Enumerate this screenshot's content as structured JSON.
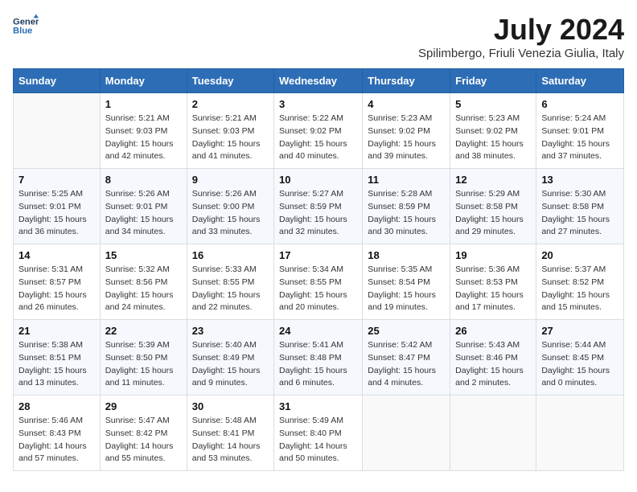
{
  "header": {
    "logo_line1": "General",
    "logo_line2": "Blue",
    "title": "July 2024",
    "location": "Spilimbergo, Friuli Venezia Giulia, Italy"
  },
  "weekdays": [
    "Sunday",
    "Monday",
    "Tuesday",
    "Wednesday",
    "Thursday",
    "Friday",
    "Saturday"
  ],
  "weeks": [
    [
      {
        "day": "",
        "sunrise": "",
        "sunset": "",
        "daylight": ""
      },
      {
        "day": "1",
        "sunrise": "Sunrise: 5:21 AM",
        "sunset": "Sunset: 9:03 PM",
        "daylight": "Daylight: 15 hours and 42 minutes."
      },
      {
        "day": "2",
        "sunrise": "Sunrise: 5:21 AM",
        "sunset": "Sunset: 9:03 PM",
        "daylight": "Daylight: 15 hours and 41 minutes."
      },
      {
        "day": "3",
        "sunrise": "Sunrise: 5:22 AM",
        "sunset": "Sunset: 9:02 PM",
        "daylight": "Daylight: 15 hours and 40 minutes."
      },
      {
        "day": "4",
        "sunrise": "Sunrise: 5:23 AM",
        "sunset": "Sunset: 9:02 PM",
        "daylight": "Daylight: 15 hours and 39 minutes."
      },
      {
        "day": "5",
        "sunrise": "Sunrise: 5:23 AM",
        "sunset": "Sunset: 9:02 PM",
        "daylight": "Daylight: 15 hours and 38 minutes."
      },
      {
        "day": "6",
        "sunrise": "Sunrise: 5:24 AM",
        "sunset": "Sunset: 9:01 PM",
        "daylight": "Daylight: 15 hours and 37 minutes."
      }
    ],
    [
      {
        "day": "7",
        "sunrise": "Sunrise: 5:25 AM",
        "sunset": "Sunset: 9:01 PM",
        "daylight": "Daylight: 15 hours and 36 minutes."
      },
      {
        "day": "8",
        "sunrise": "Sunrise: 5:26 AM",
        "sunset": "Sunset: 9:01 PM",
        "daylight": "Daylight: 15 hours and 34 minutes."
      },
      {
        "day": "9",
        "sunrise": "Sunrise: 5:26 AM",
        "sunset": "Sunset: 9:00 PM",
        "daylight": "Daylight: 15 hours and 33 minutes."
      },
      {
        "day": "10",
        "sunrise": "Sunrise: 5:27 AM",
        "sunset": "Sunset: 8:59 PM",
        "daylight": "Daylight: 15 hours and 32 minutes."
      },
      {
        "day": "11",
        "sunrise": "Sunrise: 5:28 AM",
        "sunset": "Sunset: 8:59 PM",
        "daylight": "Daylight: 15 hours and 30 minutes."
      },
      {
        "day": "12",
        "sunrise": "Sunrise: 5:29 AM",
        "sunset": "Sunset: 8:58 PM",
        "daylight": "Daylight: 15 hours and 29 minutes."
      },
      {
        "day": "13",
        "sunrise": "Sunrise: 5:30 AM",
        "sunset": "Sunset: 8:58 PM",
        "daylight": "Daylight: 15 hours and 27 minutes."
      }
    ],
    [
      {
        "day": "14",
        "sunrise": "Sunrise: 5:31 AM",
        "sunset": "Sunset: 8:57 PM",
        "daylight": "Daylight: 15 hours and 26 minutes."
      },
      {
        "day": "15",
        "sunrise": "Sunrise: 5:32 AM",
        "sunset": "Sunset: 8:56 PM",
        "daylight": "Daylight: 15 hours and 24 minutes."
      },
      {
        "day": "16",
        "sunrise": "Sunrise: 5:33 AM",
        "sunset": "Sunset: 8:55 PM",
        "daylight": "Daylight: 15 hours and 22 minutes."
      },
      {
        "day": "17",
        "sunrise": "Sunrise: 5:34 AM",
        "sunset": "Sunset: 8:55 PM",
        "daylight": "Daylight: 15 hours and 20 minutes."
      },
      {
        "day": "18",
        "sunrise": "Sunrise: 5:35 AM",
        "sunset": "Sunset: 8:54 PM",
        "daylight": "Daylight: 15 hours and 19 minutes."
      },
      {
        "day": "19",
        "sunrise": "Sunrise: 5:36 AM",
        "sunset": "Sunset: 8:53 PM",
        "daylight": "Daylight: 15 hours and 17 minutes."
      },
      {
        "day": "20",
        "sunrise": "Sunrise: 5:37 AM",
        "sunset": "Sunset: 8:52 PM",
        "daylight": "Daylight: 15 hours and 15 minutes."
      }
    ],
    [
      {
        "day": "21",
        "sunrise": "Sunrise: 5:38 AM",
        "sunset": "Sunset: 8:51 PM",
        "daylight": "Daylight: 15 hours and 13 minutes."
      },
      {
        "day": "22",
        "sunrise": "Sunrise: 5:39 AM",
        "sunset": "Sunset: 8:50 PM",
        "daylight": "Daylight: 15 hours and 11 minutes."
      },
      {
        "day": "23",
        "sunrise": "Sunrise: 5:40 AM",
        "sunset": "Sunset: 8:49 PM",
        "daylight": "Daylight: 15 hours and 9 minutes."
      },
      {
        "day": "24",
        "sunrise": "Sunrise: 5:41 AM",
        "sunset": "Sunset: 8:48 PM",
        "daylight": "Daylight: 15 hours and 6 minutes."
      },
      {
        "day": "25",
        "sunrise": "Sunrise: 5:42 AM",
        "sunset": "Sunset: 8:47 PM",
        "daylight": "Daylight: 15 hours and 4 minutes."
      },
      {
        "day": "26",
        "sunrise": "Sunrise: 5:43 AM",
        "sunset": "Sunset: 8:46 PM",
        "daylight": "Daylight: 15 hours and 2 minutes."
      },
      {
        "day": "27",
        "sunrise": "Sunrise: 5:44 AM",
        "sunset": "Sunset: 8:45 PM",
        "daylight": "Daylight: 15 hours and 0 minutes."
      }
    ],
    [
      {
        "day": "28",
        "sunrise": "Sunrise: 5:46 AM",
        "sunset": "Sunset: 8:43 PM",
        "daylight": "Daylight: 14 hours and 57 minutes."
      },
      {
        "day": "29",
        "sunrise": "Sunrise: 5:47 AM",
        "sunset": "Sunset: 8:42 PM",
        "daylight": "Daylight: 14 hours and 55 minutes."
      },
      {
        "day": "30",
        "sunrise": "Sunrise: 5:48 AM",
        "sunset": "Sunset: 8:41 PM",
        "daylight": "Daylight: 14 hours and 53 minutes."
      },
      {
        "day": "31",
        "sunrise": "Sunrise: 5:49 AM",
        "sunset": "Sunset: 8:40 PM",
        "daylight": "Daylight: 14 hours and 50 minutes."
      },
      {
        "day": "",
        "sunrise": "",
        "sunset": "",
        "daylight": ""
      },
      {
        "day": "",
        "sunrise": "",
        "sunset": "",
        "daylight": ""
      },
      {
        "day": "",
        "sunrise": "",
        "sunset": "",
        "daylight": ""
      }
    ]
  ]
}
